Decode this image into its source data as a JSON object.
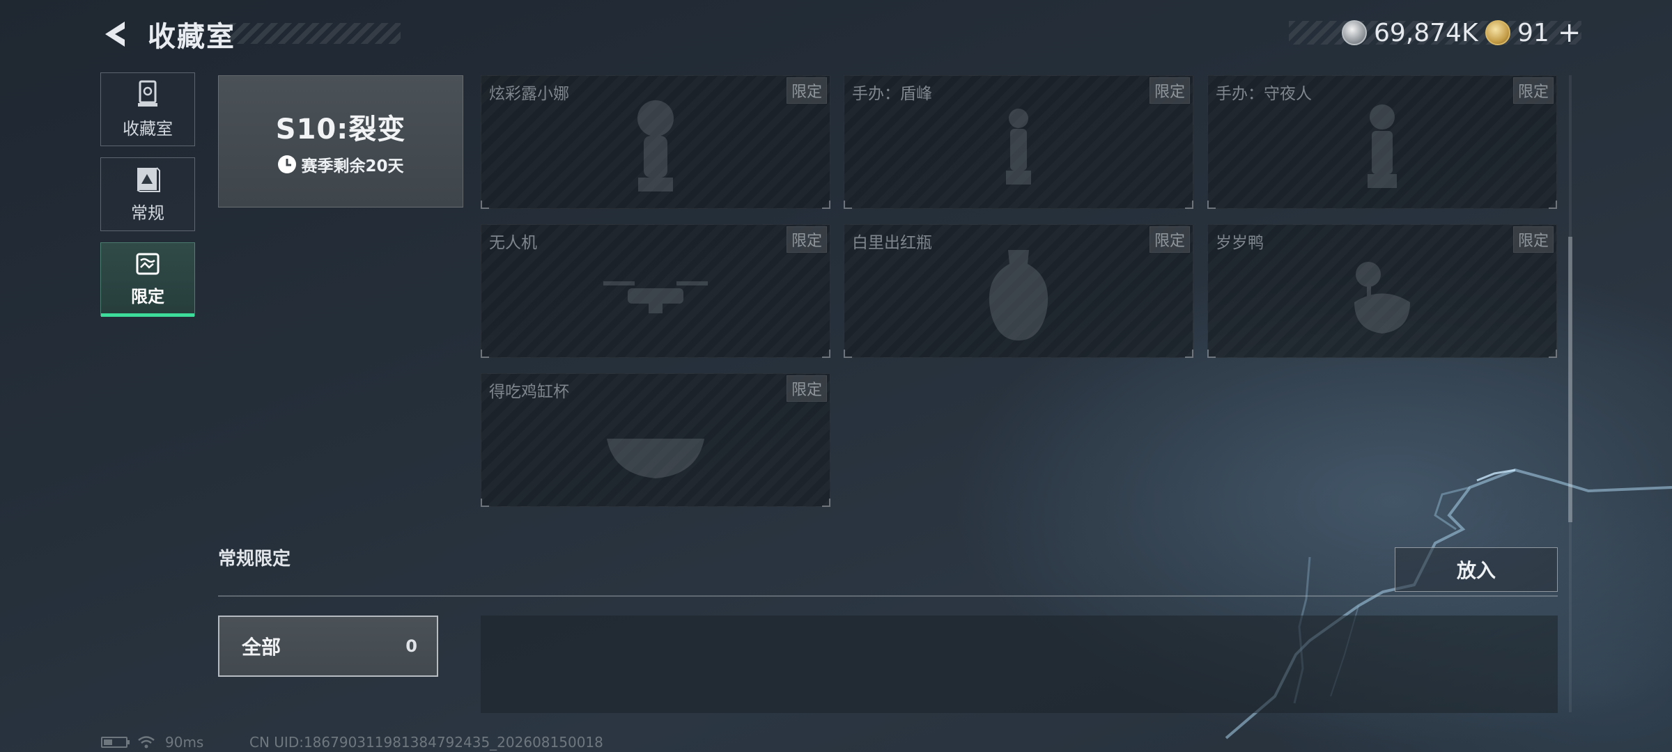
{
  "header": {
    "title": "收藏室",
    "currencies": [
      {
        "icon": "silver-coin-icon",
        "value": "69,874K"
      },
      {
        "icon": "gold-coin-icon",
        "value": "91"
      }
    ],
    "plus": "+"
  },
  "nav": {
    "items": [
      {
        "label": "收藏室",
        "icon": "trophy-case-icon",
        "active": false
      },
      {
        "label": "常规",
        "icon": "picture-frame-icon",
        "active": false
      },
      {
        "label": "限定",
        "icon": "limited-gallery-icon",
        "active": true
      }
    ]
  },
  "season": {
    "title": "S10:裂变",
    "remaining": "赛季剩余20天"
  },
  "items": [
    {
      "name": "炫彩露小娜",
      "tag": "限定",
      "art": "figure-icon"
    },
    {
      "name": "手办：盾峰",
      "tag": "限定",
      "art": "figure-icon"
    },
    {
      "name": "手办：守夜人",
      "tag": "限定",
      "art": "figure-icon"
    },
    {
      "name": "无人机",
      "tag": "限定",
      "art": "drone-icon"
    },
    {
      "name": "白里出红瓶",
      "tag": "限定",
      "art": "vase-icon"
    },
    {
      "name": "岁岁鸭",
      "tag": "限定",
      "art": "duck-icon"
    },
    {
      "name": "得吃鸡缸杯",
      "tag": "限定",
      "art": "bowl-icon"
    }
  ],
  "section": {
    "title": "常规限定",
    "put_in_label": "放入",
    "filter": {
      "label": "全部",
      "count": "0"
    }
  },
  "status": {
    "ping": "90ms",
    "uid": "CN UID:1867903119813847924​35_202608150018"
  },
  "colors": {
    "accent": "#3ddc9a",
    "background": "#252f3a"
  }
}
